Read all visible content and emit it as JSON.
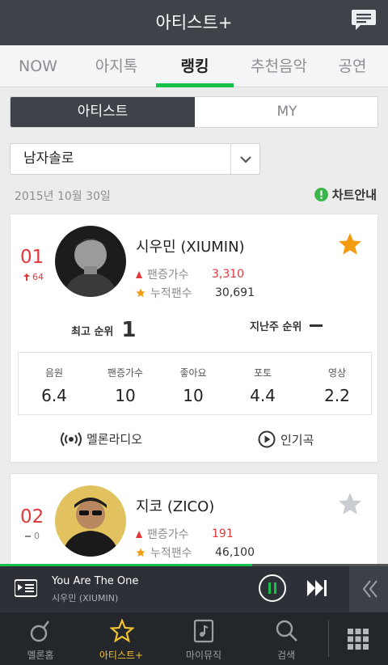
{
  "header": {
    "title": "아티스트+",
    "chat_icon": "message-icon"
  },
  "tabs": [
    {
      "label": "NOW"
    },
    {
      "label": "아지톡"
    },
    {
      "label": "랭킹",
      "active": true
    },
    {
      "label": "추천음악"
    },
    {
      "label": "공연"
    }
  ],
  "segment": {
    "options": [
      "아티스트",
      "MY"
    ],
    "selected": "아티스트"
  },
  "dropdown": {
    "value": "남자솔로"
  },
  "date": "2015년 10월 30일",
  "chart_guide": "차트안내",
  "labels": {
    "fans_increase": "팬증가수",
    "total_fans": "누적팬수",
    "best_rank": "최고 순위",
    "last_week_rank": "지난주 순위",
    "melon_radio": "멜론라디오",
    "popular_songs": "인기곡"
  },
  "colors": {
    "accent_green": "#17c04b",
    "rank_red": "#e4373a",
    "star_orange": "#f39c12",
    "header_bg": "#3e434a"
  },
  "cards": [
    {
      "rank": "01",
      "change": "64",
      "change_dir": "up",
      "name": "시우민 (XIUMIN)",
      "fans_increase": "3,310",
      "total_fans": "30,691",
      "favorited": true,
      "best_rank": "1",
      "metrics": [
        {
          "label": "음원",
          "value": "6.4"
        },
        {
          "label": "팬증가수",
          "value": "10"
        },
        {
          "label": "좋아요",
          "value": "10"
        },
        {
          "label": "포토",
          "value": "4.4"
        },
        {
          "label": "영상",
          "value": "2.2"
        }
      ]
    },
    {
      "rank": "02",
      "change": "0",
      "change_dir": "same",
      "name": "지코 (ZICO)",
      "fans_increase": "191",
      "total_fans": "46,100",
      "favorited": false
    }
  ],
  "player": {
    "song": "You Are The One",
    "artist": "시우민 (XIUMIN)",
    "progress": 0.65
  },
  "bottom_nav": [
    {
      "label": "멜론홈",
      "icon": "melon-home-icon"
    },
    {
      "label": "아티스트+",
      "icon": "star-icon",
      "active": true
    },
    {
      "label": "마이뮤직",
      "icon": "my-music-icon"
    },
    {
      "label": "검색",
      "icon": "search-icon"
    },
    {
      "label": "",
      "icon": "grid-menu-icon"
    }
  ]
}
